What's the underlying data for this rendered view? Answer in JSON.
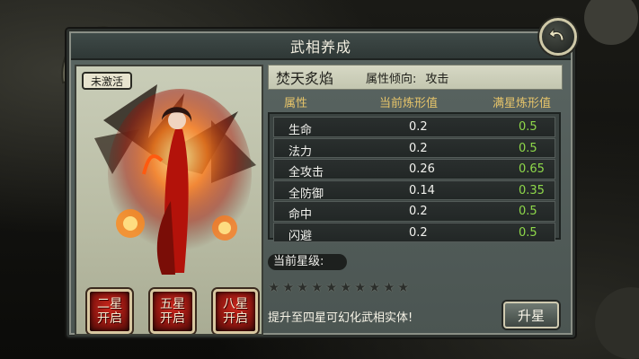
{
  "window": {
    "title": "武相养成"
  },
  "left": {
    "status_seal": "未激活",
    "star_buttons": [
      {
        "line1": "二星",
        "line2": "开启"
      },
      {
        "line1": "五星",
        "line2": "开启"
      },
      {
        "line1": "八星",
        "line2": "开启"
      }
    ]
  },
  "info": {
    "form_name": "焚天炙焰",
    "tendency_label": "属性倾向:",
    "tendency_value": "攻击"
  },
  "table": {
    "headers": {
      "attr": "属性",
      "current": "当前炼形值",
      "max": "满星炼形值"
    },
    "rows": [
      {
        "name": "生命",
        "current": "0.2",
        "max": "0.5"
      },
      {
        "name": "法力",
        "current": "0.2",
        "max": "0.5"
      },
      {
        "name": "全攻击",
        "current": "0.26",
        "max": "0.65"
      },
      {
        "name": "全防御",
        "current": "0.14",
        "max": "0.35"
      },
      {
        "name": "命中",
        "current": "0.2",
        "max": "0.5"
      },
      {
        "name": "闪避",
        "current": "0.2",
        "max": "0.5"
      }
    ]
  },
  "stars": {
    "label": "当前星级:",
    "filled": 0,
    "total": 10
  },
  "hint": "提升至四星可幻化武相实体!",
  "upgrade_label": "升星",
  "colors": {
    "header": "#e6c46a",
    "max_value": "#8ed84a",
    "star_button": "#8e1610"
  }
}
